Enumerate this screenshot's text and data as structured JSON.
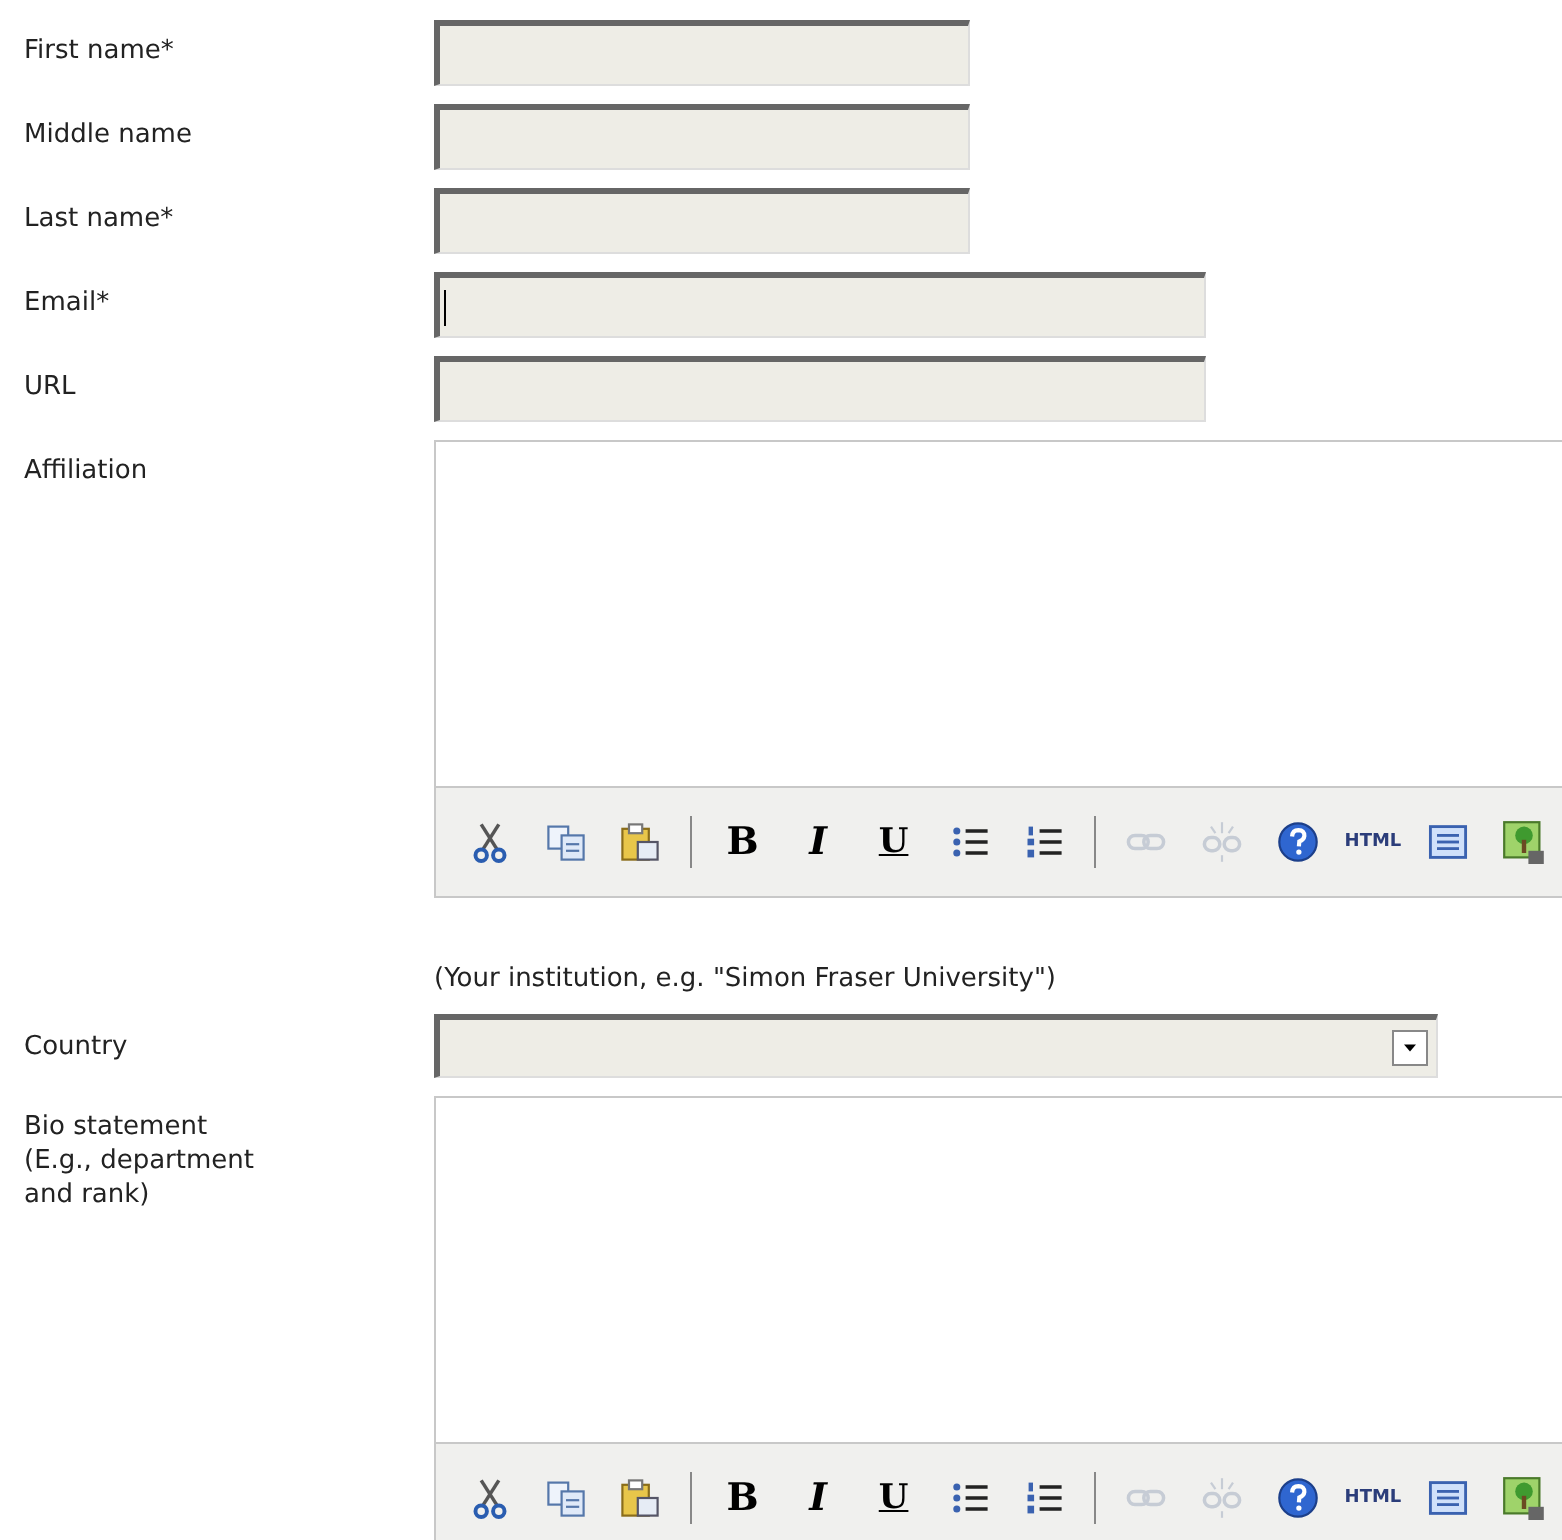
{
  "fields": [
    {
      "kind": "short_text",
      "label": "First name*",
      "focused": false
    },
    {
      "kind": "short_text",
      "label": "Middle name",
      "focused": false
    },
    {
      "kind": "short_text",
      "label": "Last name*",
      "focused": false
    },
    {
      "kind": "long_text",
      "label": "Email*",
      "focused": true
    },
    {
      "kind": "long_text",
      "label": "URL",
      "focused": false
    },
    {
      "kind": "editor",
      "label": "Affiliation",
      "toolbar": [
        {
          "kind": "cut",
          "disabled": false
        },
        {
          "kind": "copy",
          "disabled": false
        },
        {
          "kind": "paste",
          "disabled": false
        },
        {
          "kind": "separator"
        },
        {
          "kind": "bold",
          "text": "B",
          "disabled": false
        },
        {
          "kind": "italic",
          "text": "I",
          "disabled": false
        },
        {
          "kind": "underline",
          "text": "U",
          "disabled": false
        },
        {
          "kind": "bullets",
          "disabled": false
        },
        {
          "kind": "numbers",
          "disabled": false
        },
        {
          "kind": "separator"
        },
        {
          "kind": "link",
          "disabled": true
        },
        {
          "kind": "unlink",
          "disabled": true
        },
        {
          "kind": "help",
          "disabled": false
        },
        {
          "kind": "html",
          "text": "HTML",
          "disabled": false
        },
        {
          "kind": "textbox",
          "disabled": false
        },
        {
          "kind": "image",
          "disabled": false
        }
      ],
      "help": "(Your institution, e.g. \"Simon Fraser University\")"
    },
    {
      "kind": "select",
      "label": "Country"
    },
    {
      "kind": "editor",
      "label": "Bio statement (E.g., department and rank)",
      "toolbar": [
        {
          "kind": "cut",
          "disabled": false
        },
        {
          "kind": "copy",
          "disabled": false
        },
        {
          "kind": "paste",
          "disabled": false
        },
        {
          "kind": "separator"
        },
        {
          "kind": "bold",
          "text": "B",
          "disabled": false
        },
        {
          "kind": "italic",
          "text": "I",
          "disabled": false
        },
        {
          "kind": "underline",
          "text": "U",
          "disabled": false
        },
        {
          "kind": "bullets",
          "disabled": false
        },
        {
          "kind": "numbers",
          "disabled": false
        },
        {
          "kind": "separator"
        },
        {
          "kind": "link",
          "disabled": true
        },
        {
          "kind": "unlink",
          "disabled": true
        },
        {
          "kind": "help",
          "disabled": false
        },
        {
          "kind": "html",
          "text": "HTML",
          "disabled": false
        },
        {
          "kind": "textbox",
          "disabled": false
        },
        {
          "kind": "image",
          "disabled": false
        }
      ]
    }
  ]
}
